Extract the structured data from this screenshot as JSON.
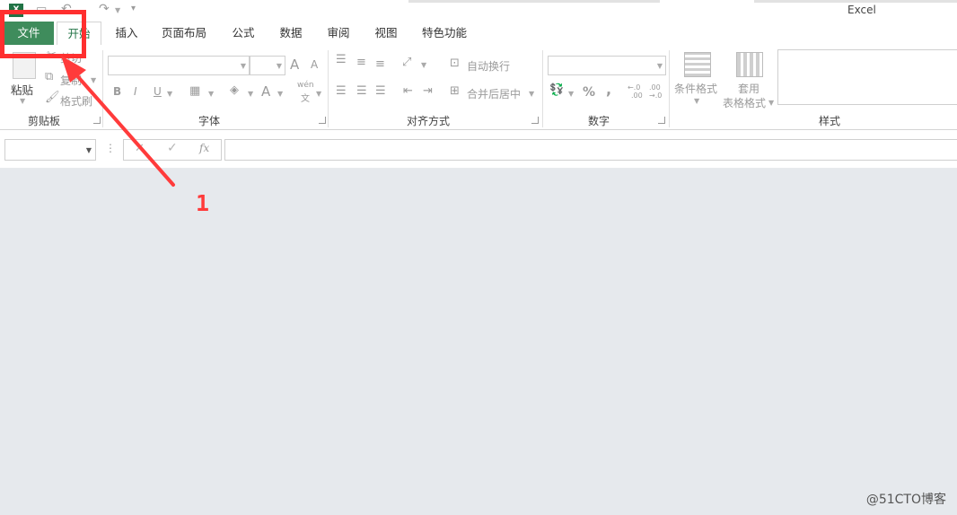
{
  "window": {
    "title": "Excel"
  },
  "quick_access": {
    "icons": [
      "excel-logo-icon",
      "save-icon",
      "undo-icon",
      "redo-icon",
      "customize-icon"
    ]
  },
  "tabs": [
    {
      "label": "文件"
    },
    {
      "label": "开始"
    },
    {
      "label": "插入"
    },
    {
      "label": "页面布局"
    },
    {
      "label": "公式"
    },
    {
      "label": "数据"
    },
    {
      "label": "审阅"
    },
    {
      "label": "视图"
    },
    {
      "label": "特色功能"
    }
  ],
  "clipboard": {
    "paste_label": "粘贴",
    "cut_label": "剪切",
    "copy_label": "复制",
    "format_painter_label": "格式刷",
    "group_label": "剪贴板"
  },
  "font": {
    "font_name": "",
    "font_size": "",
    "bold": "B",
    "italic": "I",
    "underline": "U",
    "font_color": "A",
    "grow": "A",
    "shrink": "A",
    "pinyin_top": "wén",
    "pinyin_bottom": "文",
    "group_label": "字体"
  },
  "alignment": {
    "wrap_text_label": "自动换行",
    "merge_center_label": "合并后居中",
    "group_label": "对齐方式"
  },
  "number": {
    "format": "",
    "percent": "%",
    "comma": ",",
    "inc_decimal_top": "←.0",
    "inc_decimal_bottom": ".00",
    "dec_decimal_top": ".00",
    "dec_decimal_bottom": "→.0",
    "group_label": "数字"
  },
  "styles": {
    "conditional_format_label": "条件格式",
    "table_format_line1": "套用",
    "table_format_line2": "表格格式",
    "group_label": "样式"
  },
  "formula_bar": {
    "name_box": "",
    "cancel": "✕",
    "enter": "✓",
    "fx": "fx",
    "more": "⋮",
    "formula": ""
  },
  "annotation": {
    "number": "1",
    "color": "#ff2f2f"
  },
  "watermark": {
    "text": "@51CTO博客"
  }
}
